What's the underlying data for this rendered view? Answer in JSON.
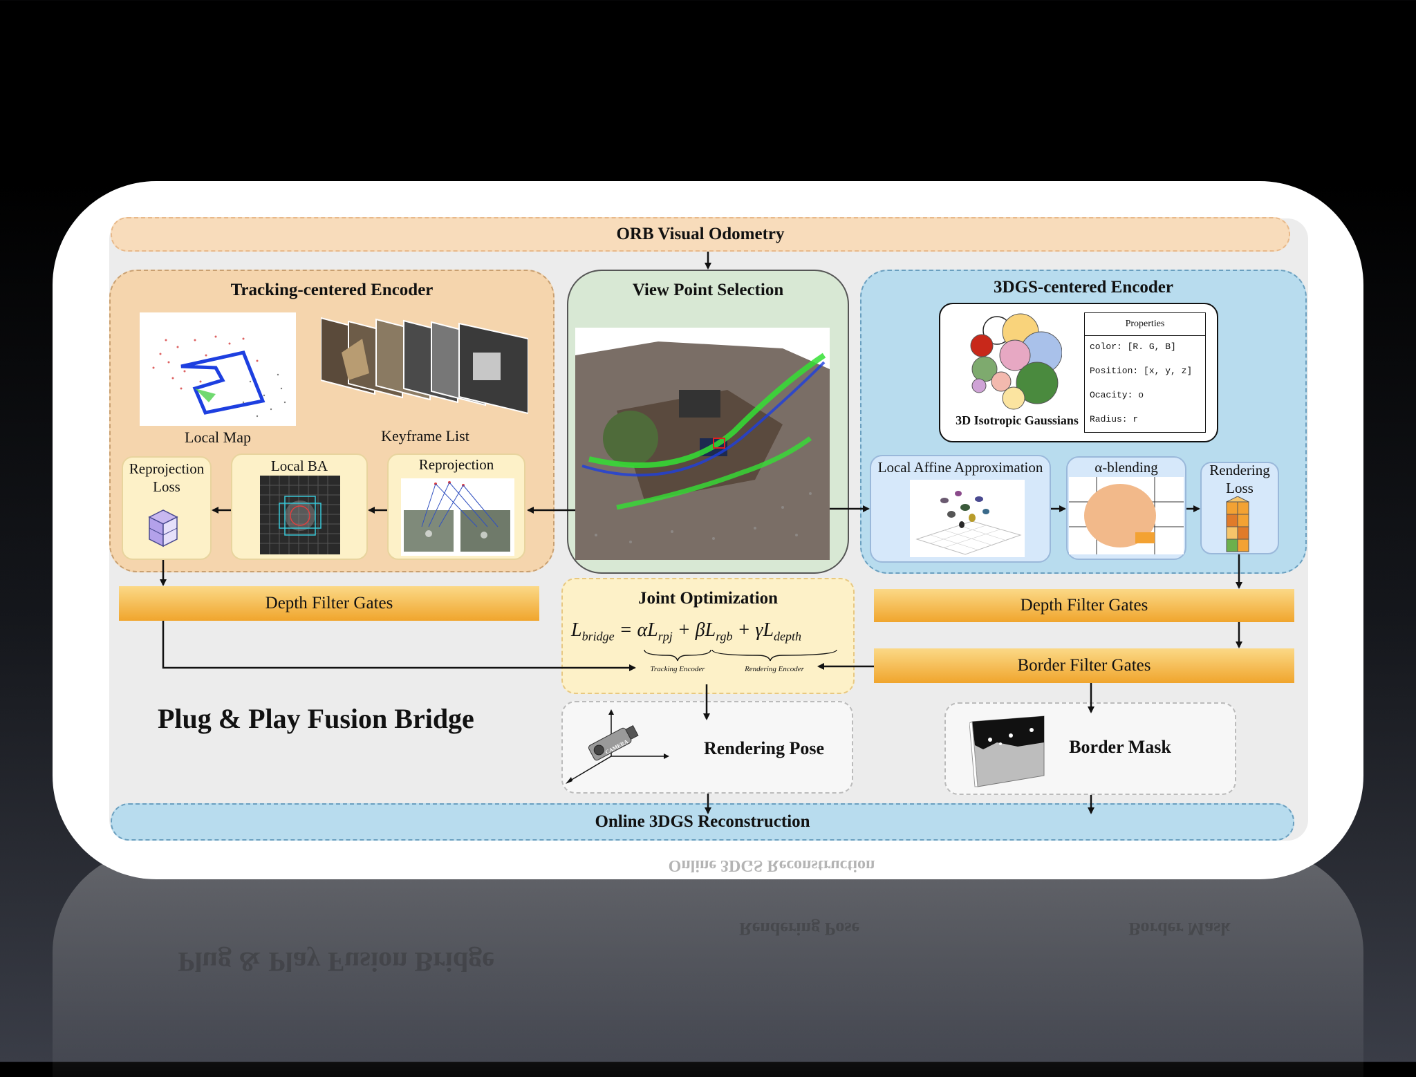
{
  "header": {
    "odometry": "ORB Visual Odometry",
    "reconstruction": "Online 3DGS Reconstruction",
    "bridge_title": "Plug & Play Fusion Bridge"
  },
  "tracking": {
    "title": "Tracking-centered Encoder",
    "local_map": "Local Map",
    "keyframe_list": "Keyframe List",
    "reprojection_loss_1": "Reprojection",
    "reprojection_loss_2": "Loss",
    "local_ba": "Local BA",
    "reprojection": "Reprojection",
    "depth_gate": "Depth Filter Gates"
  },
  "viewpoint": {
    "title": "View Point Selection"
  },
  "gs": {
    "title": "3DGS-centered Encoder",
    "gaussians_label": "3D Isotropic Gaussians",
    "properties_title": "Properties",
    "properties": [
      "color: [R. G, B]",
      "Position: [x, y, z]",
      "Ocacity: o",
      "Radius: r"
    ],
    "affine": "Local Affine Approximation",
    "alpha": "α-blending",
    "rendering_loss_1": "Rendering",
    "rendering_loss_2": "Loss",
    "depth_gate": "Depth Filter Gates",
    "border_gate": "Border Filter Gates",
    "border_mask": "Border Mask"
  },
  "joint": {
    "title": "Joint Optimization",
    "tracking_encoder": "Tracking Encoder",
    "rendering_encoder": "Rendering Encoder"
  },
  "pose": {
    "title": "Rendering Pose",
    "camera_text": "CAMERA"
  },
  "colors": {
    "peach": "#f5d5ad",
    "green": "#d8e8d4",
    "blue": "#b8dcee",
    "gate_top": "#fbd987",
    "gate_bottom": "#f0a52d",
    "yellow_box": "#fdf1c8"
  }
}
